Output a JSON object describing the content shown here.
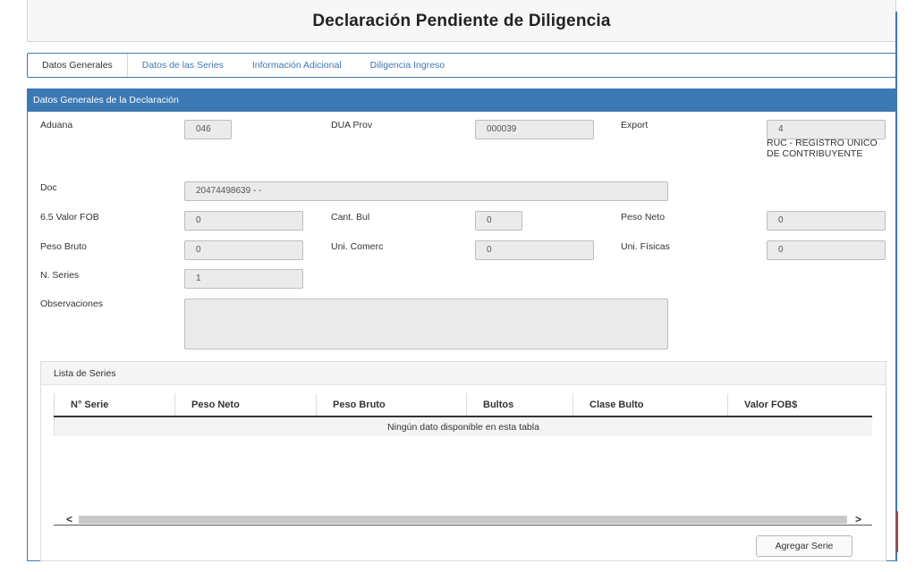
{
  "page": {
    "title": "Declaración Pendiente de Diligencia"
  },
  "tabs": [
    {
      "label": "Datos Generales"
    },
    {
      "label": "Datos de las Series"
    },
    {
      "label": "Información Adicional"
    },
    {
      "label": "Diligencia Ingreso"
    }
  ],
  "panel": {
    "title": "Datos Generales de la Declaración"
  },
  "form": {
    "aduana": {
      "label": "Aduana",
      "value": "046"
    },
    "dua_prov": {
      "label": "DUA Prov",
      "value": "000039"
    },
    "export": {
      "label": "Export",
      "value": "4",
      "note": "RUC - REGISTRO UNICO DE CONTRIBUYENTE"
    },
    "doc": {
      "label": "Doc",
      "value": "20474498639 -  -"
    },
    "valor_fob": {
      "label": "6.5 Valor FOB",
      "value": "0"
    },
    "cant_bul": {
      "label": "Cant. Bul",
      "value": "0"
    },
    "peso_neto": {
      "label": "Peso Neto",
      "value": "0"
    },
    "peso_bruto": {
      "label": "Peso Bruto",
      "value": "0"
    },
    "uni_comerc": {
      "label": "Uni. Comerc",
      "value": "0"
    },
    "uni_fisicas": {
      "label": "Uni. Físicas",
      "value": "0"
    },
    "n_series": {
      "label": "N. Series",
      "value": "1"
    },
    "observaciones": {
      "label": "Observaciones",
      "value": ""
    }
  },
  "series": {
    "title": "Lista de Series",
    "columns": [
      "N° Serie",
      "Peso Neto",
      "Peso Bruto",
      "Bultos",
      "Clase Bulto",
      "Valor FOB$"
    ],
    "empty_message": "Ningún dato disponible en esta tabla",
    "scroll_left": "<",
    "scroll_right": ">",
    "add_button": "Agregar Serie"
  }
}
